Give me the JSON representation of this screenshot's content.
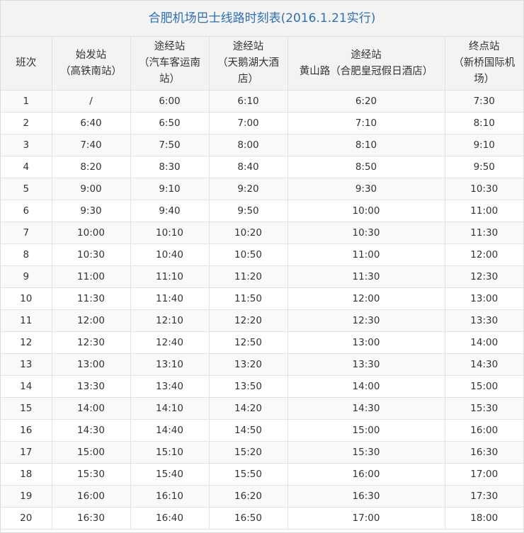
{
  "title": "合肥机场巴士线路时刻表(2016.1.21实行)",
  "columns": [
    {
      "lines": [
        "班次"
      ]
    },
    {
      "lines": [
        "始发站",
        "（高铁南站）"
      ]
    },
    {
      "lines": [
        "途经站",
        "（汽车客运南",
        "站）"
      ]
    },
    {
      "lines": [
        "途经站",
        "（天鹅湖大酒",
        "店）"
      ]
    },
    {
      "lines": [
        "途经站",
        "黄山路（合肥皇冠假日酒店）"
      ]
    },
    {
      "lines": [
        "终点站",
        "（新桥国际机",
        "场）"
      ]
    }
  ],
  "rows": [
    [
      "1",
      "/",
      "6:00",
      "6:10",
      "6:20",
      "7:30"
    ],
    [
      "2",
      "6:40",
      "6:50",
      "7:00",
      "7:10",
      "8:10"
    ],
    [
      "3",
      "7:40",
      "7:50",
      "8:00",
      "8:10",
      "9:10"
    ],
    [
      "4",
      "8:20",
      "8:30",
      "8:40",
      "8:50",
      "9:50"
    ],
    [
      "5",
      "9:00",
      "9:10",
      "9:20",
      "9:30",
      "10:30"
    ],
    [
      "6",
      "9:30",
      "9:40",
      "9:50",
      "10:00",
      "11:00"
    ],
    [
      "7",
      "10:00",
      "10:10",
      "10:20",
      "10:30",
      "11:30"
    ],
    [
      "8",
      "10:30",
      "10:40",
      "10:50",
      "11:00",
      "12:00"
    ],
    [
      "9",
      "11:00",
      "11:10",
      "11:20",
      "11:30",
      "12:30"
    ],
    [
      "10",
      "11:30",
      "11:40",
      "11:50",
      "12:00",
      "13:00"
    ],
    [
      "11",
      "12:00",
      "12:10",
      "12:20",
      "12:30",
      "13:30"
    ],
    [
      "12",
      "12:30",
      "12:40",
      "12:50",
      "13:00",
      "14:00"
    ],
    [
      "13",
      "13:00",
      "13:10",
      "13:20",
      "13:30",
      "14:30"
    ],
    [
      "14",
      "13:30",
      "13:40",
      "13:50",
      "14:00",
      "15:00"
    ],
    [
      "15",
      "14:00",
      "14:10",
      "14:20",
      "14:30",
      "15:30"
    ],
    [
      "16",
      "14:30",
      "14:40",
      "14:50",
      "15:00",
      "16:00"
    ],
    [
      "17",
      "15:00",
      "15:10",
      "15:20",
      "15:30",
      "16:30"
    ],
    [
      "18",
      "15:30",
      "15:40",
      "15:50",
      "16:00",
      "17:00"
    ],
    [
      "19",
      "16:00",
      "16:10",
      "16:20",
      "16:30",
      "17:30"
    ],
    [
      "20",
      "16:30",
      "16:40",
      "16:50",
      "17:00",
      "18:00"
    ]
  ]
}
